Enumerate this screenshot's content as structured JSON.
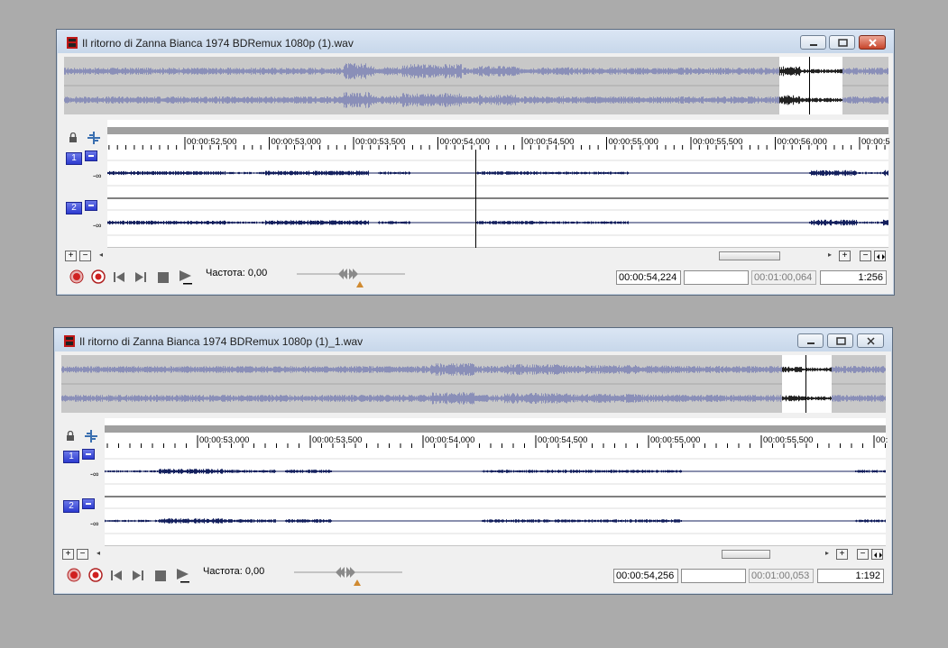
{
  "windows": [
    {
      "title": "Il ritorno di Zanna Bianca 1974 BDRemux 1080p (1).wav",
      "ruler_ticks": [
        "00:00:52,500",
        "00:00:53,000",
        "00:00:53,500",
        "00:00:54,000",
        "00:00:54,500",
        "00:00:55,000",
        "00:00:55,500",
        "00:00:56,000",
        "00:00:5"
      ],
      "channels": [
        {
          "number": "1",
          "db": "-∞"
        },
        {
          "number": "2",
          "db": "-∞"
        }
      ],
      "frequency_label": "Частота: 0,00",
      "position": "00:00:54,224",
      "selection": "",
      "length": "00:01:00,064",
      "zoom": "1:256",
      "close_active": true
    },
    {
      "title": "Il ritorno di Zanna Bianca 1974 BDRemux 1080p (1)_1.wav",
      "ruler_ticks": [
        "00:00:53,000",
        "00:00:53,500",
        "00:00:54,000",
        "00:00:54,500",
        "00:00:55,000",
        "00:00:55,500",
        "00:"
      ],
      "channels": [
        {
          "number": "1",
          "db": "-∞"
        },
        {
          "number": "2",
          "db": "-∞"
        }
      ],
      "frequency_label": "Частота: 0,00",
      "position": "00:00:54,256",
      "selection": "",
      "length": "00:01:00,053",
      "zoom": "1:192",
      "close_active": false
    }
  ],
  "controls": {
    "zoom_in": "+",
    "zoom_out": "−",
    "scroll_left": "◂",
    "scroll_right": "▸"
  },
  "icons": {
    "lock": "lock-icon",
    "snap": "snap-icon",
    "record": "record-icon",
    "record_arm": "record-arm-icon",
    "prev": "go-to-start-icon",
    "next": "go-to-end-icon",
    "stop": "stop-icon",
    "play": "play-icon"
  },
  "colors": {
    "waveform": "#14205e",
    "overview_wave": "#8a8fb8",
    "channel_button": "#3a47d6",
    "record": "#d02020",
    "close_button": "#c7442b"
  }
}
